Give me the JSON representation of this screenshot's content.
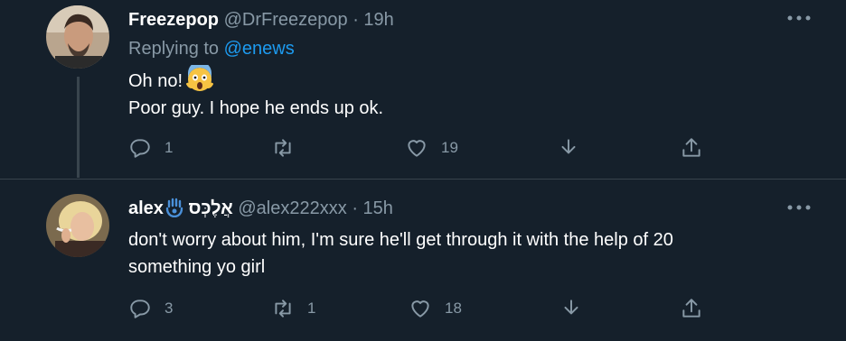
{
  "tweets": [
    {
      "author": "Freezepop",
      "handle": "@DrFreezepop",
      "separator": "·",
      "time": "19h",
      "replying_prefix": "Replying to",
      "replying_to": "@enews",
      "lines": [
        "Oh no!",
        "Poor guy. I hope he ends up ok."
      ],
      "emoji": "😱",
      "reply_count": "1",
      "retweet_count": "",
      "like_count": "19"
    },
    {
      "author": "alex",
      "author_extra": "אֲלֶכְּס",
      "handle": "@alex222xxx",
      "separator": "·",
      "time": "15h",
      "lines": [
        "don't worry about him, I'm sure he'll get through it with the help of 20",
        "something yo girl"
      ],
      "reply_count": "3",
      "retweet_count": "1",
      "like_count": "18"
    }
  ],
  "colors": {
    "background": "#15202b",
    "secondary_text": "#8899a6",
    "link": "#1d9bf0",
    "divider": "#38444d"
  },
  "icons": [
    "reply-icon",
    "retweet-icon",
    "like-icon",
    "share-icon",
    "upload-icon",
    "more-icon",
    "hamsa-icon"
  ]
}
